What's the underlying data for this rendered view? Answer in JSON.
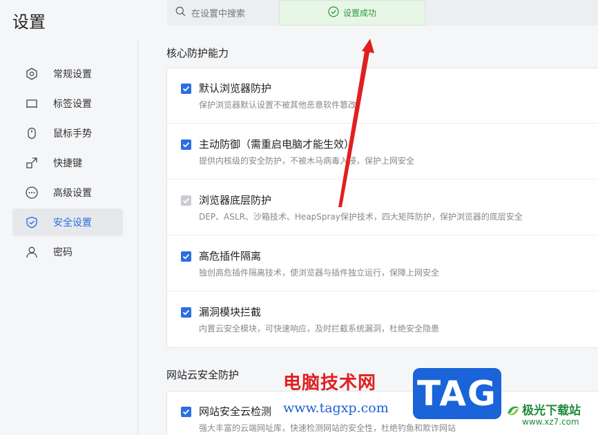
{
  "app": {
    "title": "设置"
  },
  "search": {
    "placeholder": "在设置中搜索"
  },
  "toast": {
    "text": "设置成功"
  },
  "sidebar": {
    "items": [
      {
        "label": "常规设置",
        "icon": "gear-hex-icon",
        "active": false
      },
      {
        "label": "标签设置",
        "icon": "tab-icon",
        "active": false
      },
      {
        "label": "鼠标手势",
        "icon": "mouse-icon",
        "active": false
      },
      {
        "label": "快捷键",
        "icon": "shortcut-icon",
        "active": false
      },
      {
        "label": "高级设置",
        "icon": "more-icon",
        "active": false
      },
      {
        "label": "安全设置",
        "icon": "shield-icon",
        "active": true
      },
      {
        "label": "密码",
        "icon": "user-icon",
        "active": false
      }
    ]
  },
  "sections": [
    {
      "title": "核心防护能力",
      "options": [
        {
          "title": "默认浏览器防护",
          "desc": "保护浏览器默认设置不被其他恶意软件篡改",
          "checked": true,
          "disabled": false
        },
        {
          "title": "主动防御（需重启电脑才能生效）",
          "desc": "提供内核级的安全防护，不被木马病毒入侵，保护上网安全",
          "checked": true,
          "disabled": false
        },
        {
          "title": "浏览器底层防护",
          "desc": "DEP、ASLR、沙箱技术、HeapSpray保护技术，四大矩阵防护，保护浏览器的底层安全",
          "checked": true,
          "disabled": true
        },
        {
          "title": "高危插件隔离",
          "desc": "独创高危插件隔离技术，使浏览器与插件独立运行，保障上网安全",
          "checked": true,
          "disabled": false
        },
        {
          "title": "漏洞模块拦截",
          "desc": "内置云安全模块，可快速响应，及时拦截系统漏洞，杜绝安全隐患",
          "checked": true,
          "disabled": false
        }
      ]
    },
    {
      "title": "网站云安全防护",
      "options": [
        {
          "title": "网站安全云检测",
          "desc": "强大丰富的云端网址库，快速检测网站的安全性，杜绝钓鱼和欺诈网站",
          "checked": true,
          "disabled": false
        }
      ]
    }
  ],
  "watermark": {
    "brand_cn": "电脑技术网",
    "url": "www.tagxp.com",
    "tag": "TAG",
    "site_cn": "极光下载站",
    "site_url": "www.xz7.com"
  },
  "colors": {
    "accent": "#2b6fe0",
    "success": "#2c9b3a",
    "annotation_arrow": "#e02020"
  }
}
